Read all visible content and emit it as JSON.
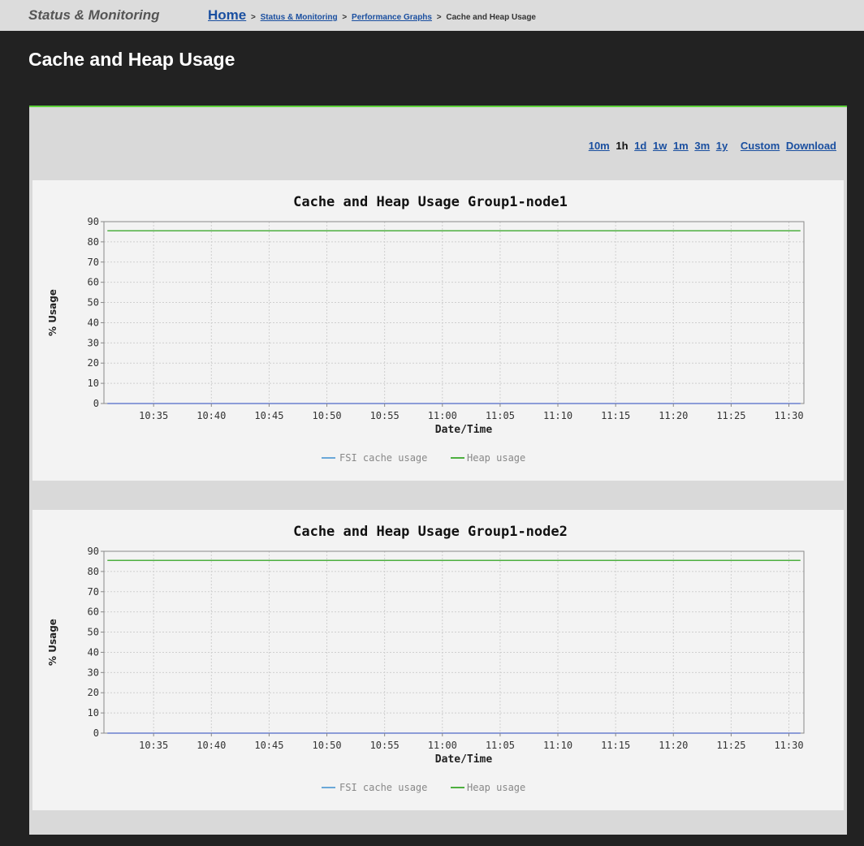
{
  "header": {
    "section": "Status & Monitoring",
    "breadcrumb": {
      "home": "Home",
      "sep": ">",
      "status": "Status & Monitoring",
      "graphs": "Performance Graphs",
      "current": "Cache and Heap Usage"
    }
  },
  "page": {
    "title": "Cache and Heap Usage"
  },
  "ranges": {
    "items": [
      "10m",
      "1h",
      "1d",
      "1w",
      "1m",
      "3m",
      "1y"
    ],
    "selected": "1h",
    "custom": "Custom",
    "download": "Download"
  },
  "charts": [
    {
      "title": "Cache and Heap Usage Group1-node1",
      "xlabel": "Date/Time",
      "ylabel": "% Usage",
      "yticks": [
        0,
        10,
        20,
        30,
        40,
        50,
        60,
        70,
        80,
        90
      ],
      "xticks": [
        "10:35",
        "10:40",
        "10:45",
        "10:50",
        "10:55",
        "11:00",
        "11:05",
        "11:10",
        "11:15",
        "11:20",
        "11:25",
        "11:30"
      ],
      "legend": [
        "FSI cache usage",
        "Heap usage"
      ]
    },
    {
      "title": "Cache and Heap Usage Group1-node2",
      "xlabel": "Date/Time",
      "ylabel": "% Usage",
      "yticks": [
        0,
        10,
        20,
        30,
        40,
        50,
        60,
        70,
        80,
        90
      ],
      "xticks": [
        "10:35",
        "10:40",
        "10:45",
        "10:50",
        "10:55",
        "11:00",
        "11:05",
        "11:10",
        "11:15",
        "11:20",
        "11:25",
        "11:30"
      ],
      "legend": [
        "FSI cache usage",
        "Heap usage"
      ]
    }
  ],
  "colors": {
    "fsi": "#6aa8d8",
    "heap": "#4daf3f",
    "accent": "#5fd33c",
    "link": "#1a4fa0"
  },
  "chart_data": [
    {
      "type": "line",
      "title": "Cache and Heap Usage Group1-node1",
      "xlabel": "Date/Time",
      "ylabel": "% Usage",
      "ylim": [
        0,
        90
      ],
      "x": [
        "10:31",
        "11:31"
      ],
      "xticks": [
        "10:35",
        "10:40",
        "10:45",
        "10:50",
        "10:55",
        "11:00",
        "11:05",
        "11:10",
        "11:15",
        "11:20",
        "11:25",
        "11:30"
      ],
      "series": [
        {
          "name": "FSI cache usage",
          "values": [
            0,
            0
          ]
        },
        {
          "name": "Heap usage",
          "values": [
            85.5,
            85.5
          ]
        }
      ],
      "grid": true,
      "legend": "bottom"
    },
    {
      "type": "line",
      "title": "Cache and Heap Usage Group1-node2",
      "xlabel": "Date/Time",
      "ylabel": "% Usage",
      "ylim": [
        0,
        90
      ],
      "x": [
        "10:31",
        "11:31"
      ],
      "xticks": [
        "10:35",
        "10:40",
        "10:45",
        "10:50",
        "10:55",
        "11:00",
        "11:05",
        "11:10",
        "11:15",
        "11:20",
        "11:25",
        "11:30"
      ],
      "series": [
        {
          "name": "FSI cache usage",
          "values": [
            0,
            0
          ]
        },
        {
          "name": "Heap usage",
          "values": [
            85.5,
            85.5
          ]
        }
      ],
      "grid": true,
      "legend": "bottom"
    }
  ]
}
